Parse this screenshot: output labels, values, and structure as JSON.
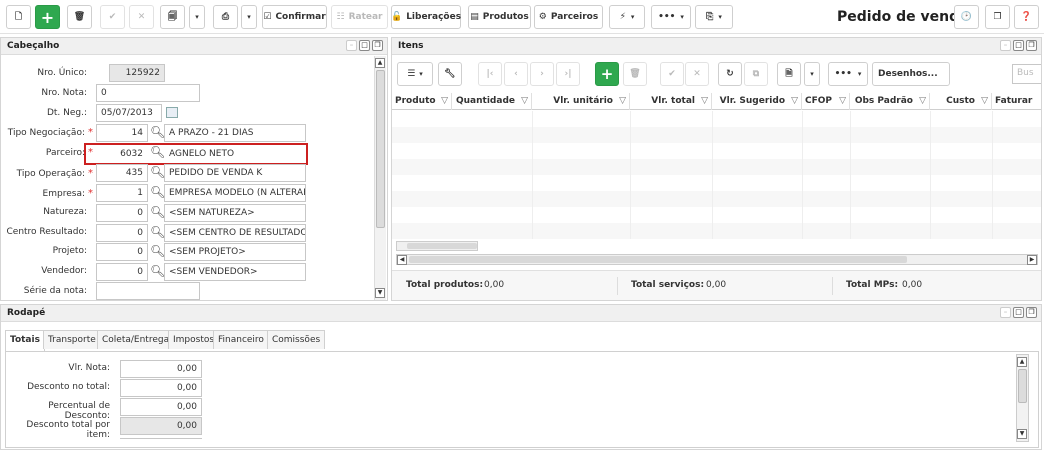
{
  "toolbar": {
    "confirmar": "Confirmar",
    "ratear": "Ratear",
    "liberacoes": "Liberações",
    "produtos": "Produtos",
    "parceiros": "Parceiros",
    "more": "•••"
  },
  "page_title": "Pedido de venda",
  "cabecalho": {
    "title": "Cabeçalho",
    "fields": {
      "nro_unico_label": "Nro. Único:",
      "nro_unico": "125922",
      "nro_nota_label": "Nro. Nota:",
      "nro_nota": "0",
      "dt_neg_label": "Dt. Neg.:",
      "dt_neg": "05/07/2013",
      "tipo_negociacao_label": "Tipo Negociação:",
      "tipo_negociacao_code": "14",
      "tipo_negociacao_desc": "A PRAZO - 21 DIAS",
      "parceiro_label": "Parceiro:",
      "parceiro_code": "6032",
      "parceiro_desc": "AGNELO NETO",
      "tipo_operacao_label": "Tipo Operação:",
      "tipo_operacao_code": "435",
      "tipo_operacao_desc": "PEDIDO DE VENDA K",
      "empresa_label": "Empresa:",
      "empresa_code": "1",
      "empresa_desc": "EMPRESA MODELO (N ALTERAR)",
      "natureza_label": "Natureza:",
      "natureza_code": "0",
      "natureza_desc": "<SEM NATUREZA>",
      "centro_label": "Centro Resultado:",
      "centro_code": "0",
      "centro_desc": "<SEM CENTRO DE RESULTADO>>",
      "projeto_label": "Projeto:",
      "projeto_code": "0",
      "projeto_desc": "<SEM PROJETO>",
      "vendedor_label": "Vendedor:",
      "vendedor_code": "0",
      "vendedor_desc": "<SEM VENDEDOR>",
      "serie_label": "Série da nota:",
      "serie": ""
    },
    "required_mark": "*"
  },
  "itens": {
    "title": "Itens",
    "desenhos": "Desenhos...",
    "search_placeholder": "Bus",
    "columns": [
      "Produto",
      "Quantidade",
      "Vlr. unitário",
      "Vlr. total",
      "Vlr. Sugerido",
      "CFOP",
      "Obs Padrão",
      "Custo",
      "Faturar"
    ],
    "totals": {
      "produtos_label": "Total produtos:",
      "produtos": "0,00",
      "servicos_label": "Total serviços:",
      "servicos": "0,00",
      "mps_label": "Total MPs:",
      "mps": "0,00"
    }
  },
  "rodape": {
    "title": "Rodapé",
    "tabs": [
      "Totais",
      "Transporte",
      "Coleta/Entrega",
      "Impostos",
      "Financeiro",
      "Comissões"
    ],
    "fields": {
      "vlr_nota_label": "Vlr. Nota:",
      "vlr_nota": "0,00",
      "desconto_label": "Desconto no total:",
      "desconto": "0,00",
      "perc_label": "Percentual de Desconto:",
      "perc": "0,00",
      "desc_item_label": "Desconto total por item:",
      "desc_item": "0,00"
    }
  }
}
